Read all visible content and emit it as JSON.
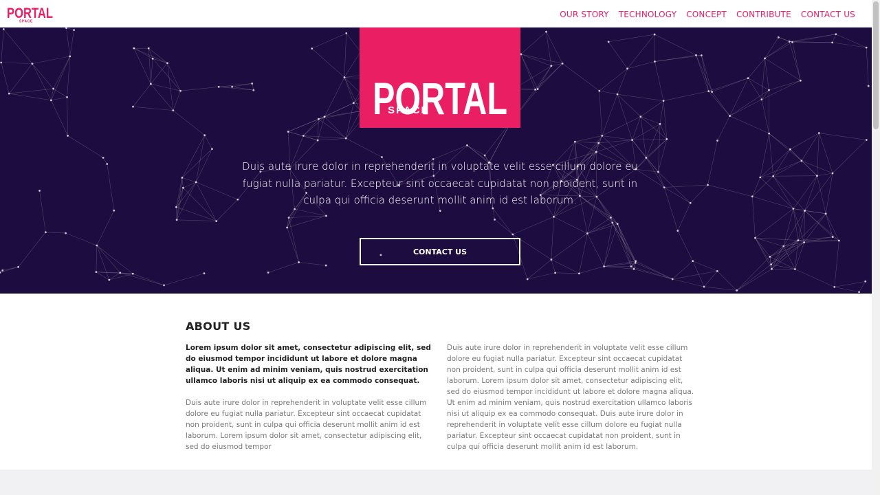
{
  "brand": {
    "logo_main": "PORTAL",
    "logo_sub": "SPACE",
    "accent_color": "#e91e63",
    "hero_bg_color": "#1d0c3f"
  },
  "nav": {
    "items": [
      {
        "label": "OUR STORY"
      },
      {
        "label": "TECHNOLOGY"
      },
      {
        "label": "CONCEPT"
      },
      {
        "label": "CONTRIBUTE"
      },
      {
        "label": "CONTACT US"
      }
    ]
  },
  "hero": {
    "text": "Duis aute irure dolor in reprehenderit in voluptate velit esse cillum dolore eu fugiat nulla pariatur. Excepteur sint occaecat cupidatat non proident, sunt in culpa qui officia deserunt mollit anim id est laborum.",
    "button_label": "CONTACT US"
  },
  "about": {
    "title": "ABOUT US",
    "lead": "Lorem ipsum dolor sit amet, consectetur adipiscing elit, sed do eiusmod tempor incididunt ut labore et dolore magna aliqua. Ut enim ad minim veniam, quis nostrud exercitation ullamco laboris nisi ut aliquip ex ea commodo consequat.",
    "left_body": "Duis aute irure dolor in reprehenderit in voluptate velit esse cillum dolore eu fugiat nulla pariatur. Excepteur sint occaecat cupidatat non proident, sunt in culpa qui officia deserunt mollit anim id est laborum. Lorem ipsum dolor sit amet, consectetur adipiscing elit, sed do eiusmod tempor",
    "right_body": "Duis aute irure dolor in reprehenderit in voluptate velit esse cillum dolore eu fugiat nulla pariatur. Excepteur sint occaecat cupidatat non proident, sunt in culpa qui officia deserunt mollit anim id est laborum. Lorem ipsum dolor sit amet, consectetur adipiscing elit, sed do eiusmod tempor incididunt ut labore et dolore magna aliqua. Ut enim ad minim veniam, quis nostrud exercitation ullamco laboris nisi ut aliquip ex ea commodo consequat. Duis aute irure dolor in reprehenderit in voluptate velit esse cillum dolore eu fugiat nulla pariatur. Excepteur sint occaecat cupidatat non proident, sunt in culpa qui officia deserunt mollit anim id est laborum."
  }
}
